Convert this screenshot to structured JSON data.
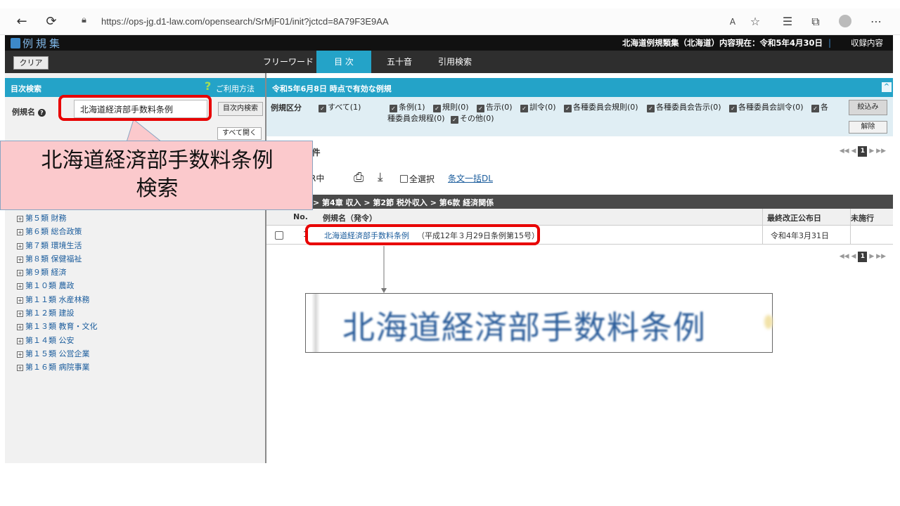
{
  "browser": {
    "url": "https://ops-jg.d1-law.com/opensearch/SrMjF01/init?jctcd=8A79F3E9AA"
  },
  "app": {
    "logo_text": "例規集",
    "header_info": "北海道例規類集（北海道）内容現在：令和5年4月30日",
    "header_contents": "収録内容"
  },
  "tabs": [
    {
      "label": "フリーワード"
    },
    {
      "label": "目 次"
    },
    {
      "label": "五十音"
    },
    {
      "label": "引用検索"
    }
  ],
  "left": {
    "clear_label": "クリア",
    "title": "目次検索",
    "help_label": "ご利用方法",
    "name_label": "例規名",
    "name_value": "北海道経済部手数料条例",
    "toc_search_label": "目次内検索",
    "expand_label": "すべて開く",
    "tree": [
      "第５類 財務",
      "第６類 総合政策",
      "第７類 環境生活",
      "第８類 保健福祉",
      "第９類 経済",
      "第１０類 農政",
      "第１１類 水産林務",
      "第１２類 建設",
      "第１３類 教育・文化",
      "第１４類 公安",
      "第１５類 公営企業",
      "第１６類 病院事業"
    ]
  },
  "right": {
    "title": "令和5年6月8日 時点で有効な例規",
    "filter_label": "例規区分",
    "options": [
      "すべて(1)",
      "条例(1)",
      "規則(0)",
      "告示(0)",
      "訓令(0)",
      "各種委員会規則(0)",
      "各種委員会告示(0)",
      "各種委員会訓令(0)",
      "各",
      "種委員会規程(0)",
      "その他(0)"
    ],
    "narrow_label": "絞込み",
    "release_label": "解除",
    "count_text": "：1 件",
    "pager_current": "1",
    "tool_fragment": "R中",
    "select_all_label": "全選択",
    "bulk_dl_label": "条文一括DL",
    "breadcrumb": "> 第4章 収入 > 第2節 税外収入 > 第6款 経済関係",
    "columns": {
      "no": "No.",
      "name": "例規名（発令）",
      "date": "最終改正公布日",
      "pending": "未施行"
    },
    "row": {
      "no": "1",
      "name": "北海道経済部手数料条例",
      "promulgation": "（平成12年３月29日条例第15号）",
      "date": "令和4年3月31日"
    }
  },
  "annotation": {
    "callout_text": "北海道経済部手数料条例\n検索",
    "zoom_text": "北海道経済部手数料条例",
    "highlight_color": "#e80000",
    "callout_bg": "#fbc9cc"
  }
}
